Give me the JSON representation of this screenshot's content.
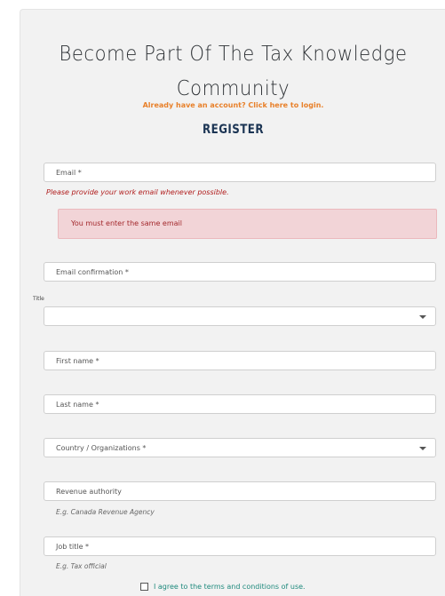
{
  "header": {
    "title_line1": "Become Part Of The Tax Knowledge",
    "title_line2": "Community",
    "login_link": "Already have an account? Click here to login.",
    "register_heading": "REGISTER"
  },
  "form": {
    "email_placeholder": "Email *",
    "email_hint": "Please provide your work email whenever possible.",
    "alert_message": "You must enter the same email",
    "email_confirmation_placeholder": "Email confirmation *",
    "title_label": "Title",
    "title_value": "",
    "first_name_placeholder": "First name *",
    "last_name_placeholder": "Last name *",
    "country_placeholder": "Country / Organizations *",
    "revenue_placeholder": "Revenue authority",
    "revenue_hint": "E.g. Canada Revenue Agency",
    "job_title_placeholder": "Job title *",
    "job_title_hint": "E.g. Tax official",
    "terms_label": "I agree to the terms and conditions of use."
  },
  "colors": {
    "accent_orange": "#e8802a",
    "error_red": "#b01c1c",
    "alert_bg": "#f2d4d7",
    "heading_navy": "#1c3554",
    "terms_teal": "#1f8a7d"
  }
}
